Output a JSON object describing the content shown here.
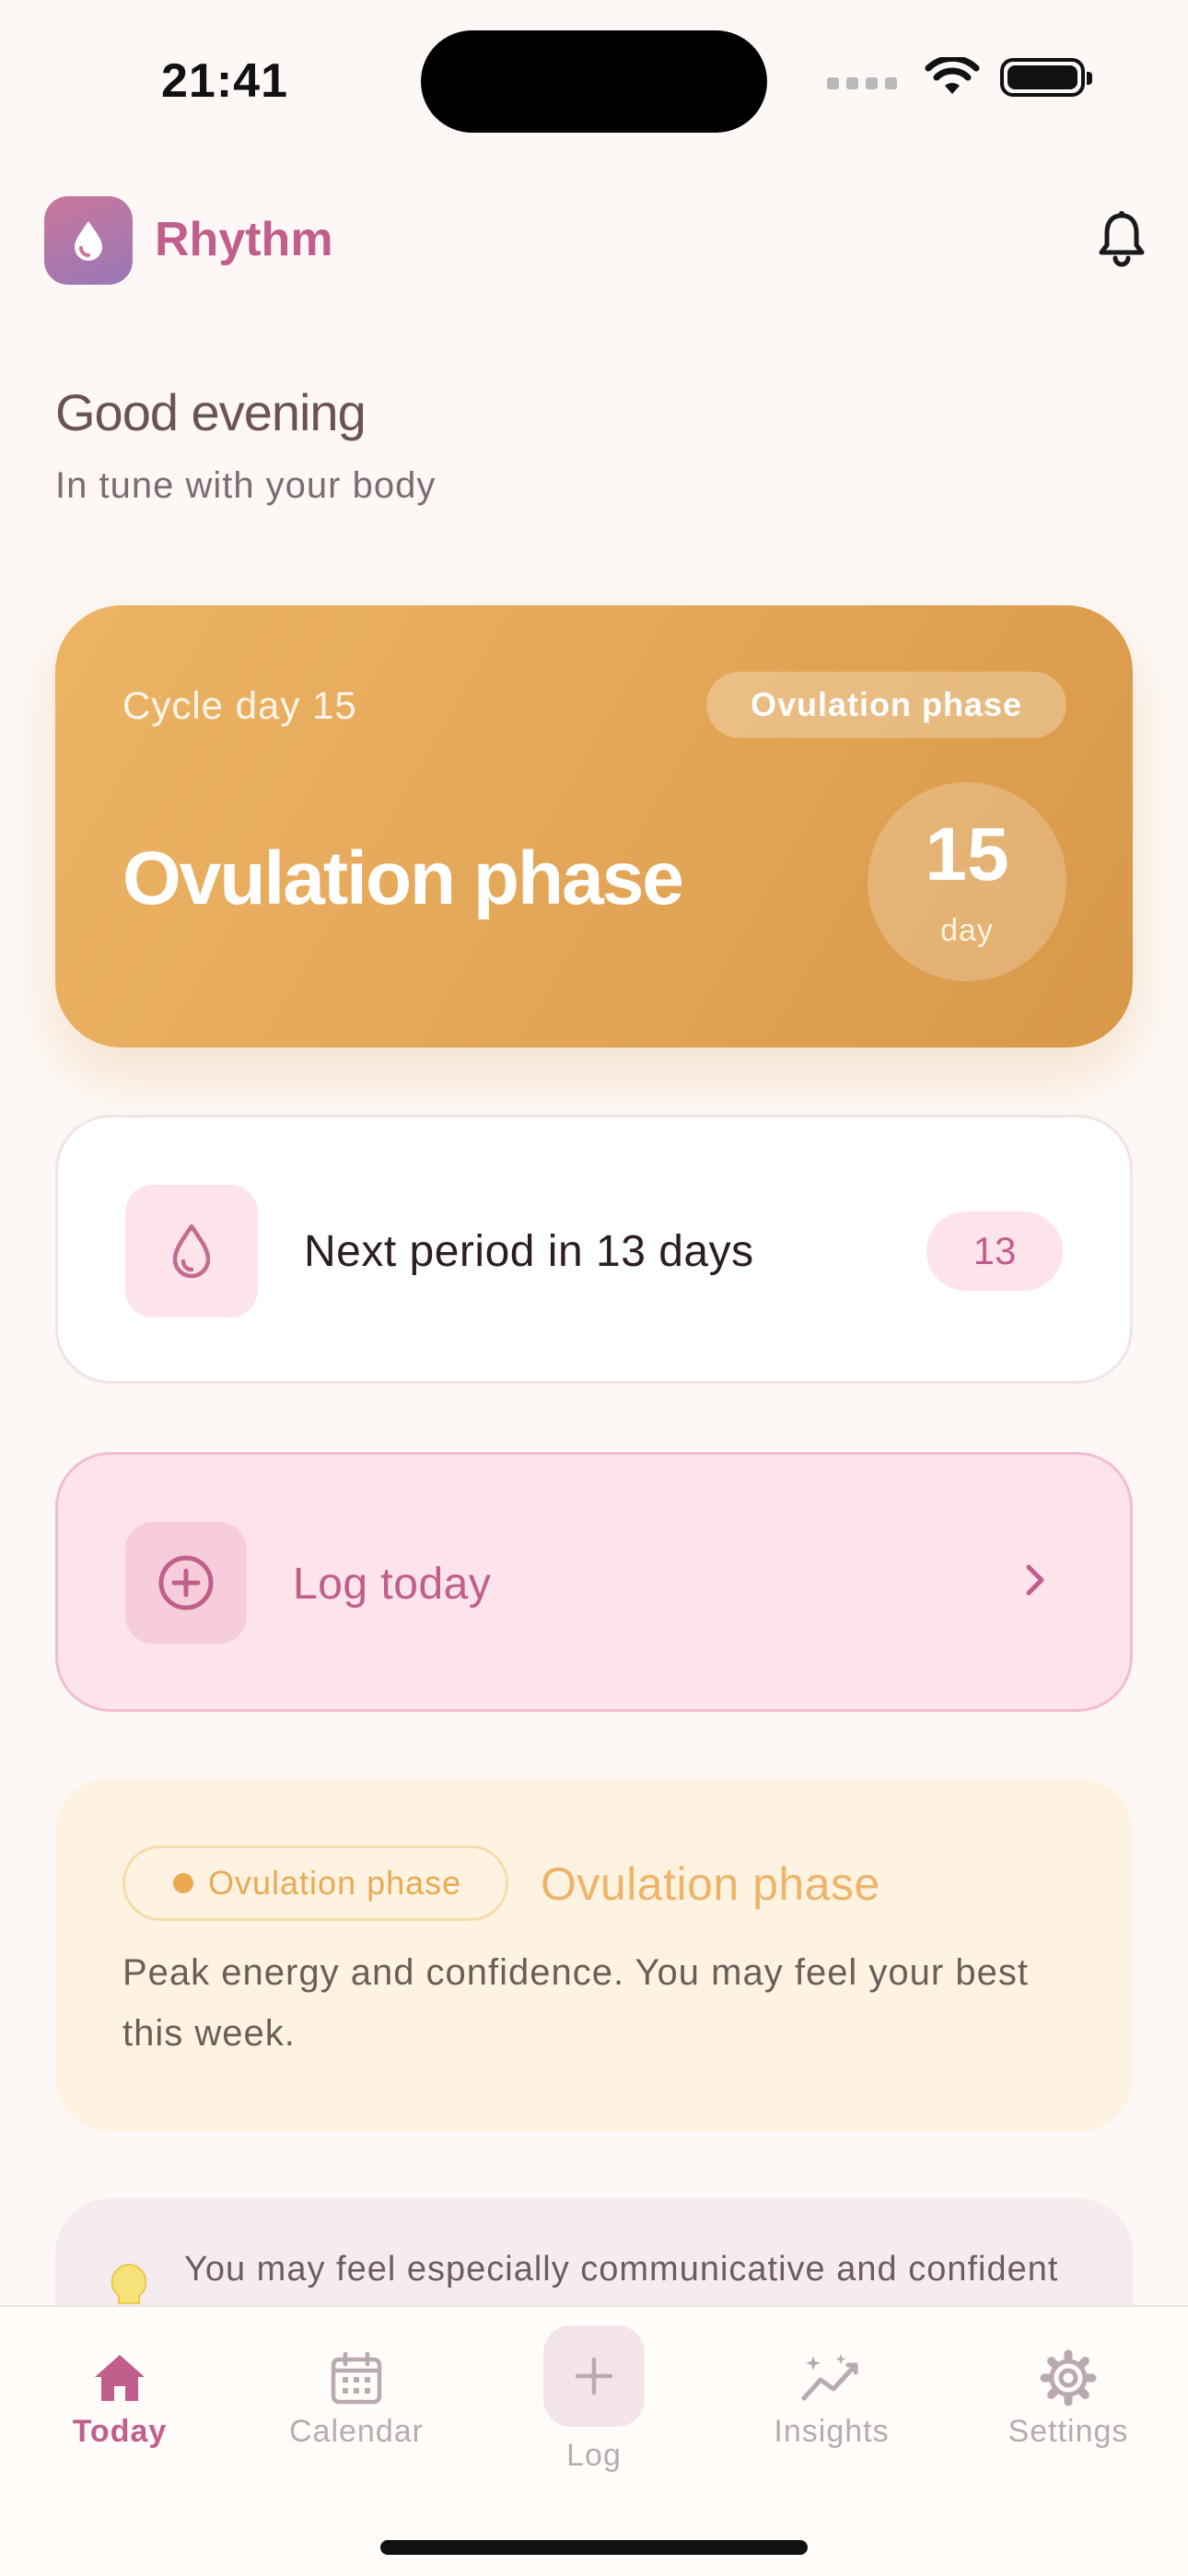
{
  "status_bar": {
    "time": "21:41"
  },
  "header": {
    "app_name": "Rhythm"
  },
  "greeting": {
    "title": "Good evening",
    "subtitle": "In tune with your body"
  },
  "phase_card": {
    "cycle_label": "Cycle day 15",
    "phase_pill": "Ovulation phase",
    "phase_title": "Ovulation phase",
    "day_number": "15",
    "day_label": "day"
  },
  "next_period": {
    "text": "Next period in 13 days",
    "badge": "13"
  },
  "log_today": {
    "label": "Log today"
  },
  "phase_info": {
    "pill": "Ovulation phase",
    "title": "Ovulation phase",
    "description": "Peak energy and confidence. You may feel your best this week."
  },
  "tip": {
    "text": "You may feel especially communicative and confident"
  },
  "tabs": [
    {
      "label": "Today",
      "icon": "home-icon",
      "active": true
    },
    {
      "label": "Calendar",
      "icon": "calendar-icon"
    },
    {
      "label": "Log",
      "icon": "plus-icon"
    },
    {
      "label": "Insights",
      "icon": "insights-icon"
    },
    {
      "label": "Settings",
      "icon": "gear-icon"
    }
  ],
  "colors": {
    "brand": "#c15f8c",
    "background": "#fdf8f5",
    "phase_orange": "#e2a556",
    "pink_light": "#fde3ea",
    "info_bg": "#fef3e1"
  }
}
